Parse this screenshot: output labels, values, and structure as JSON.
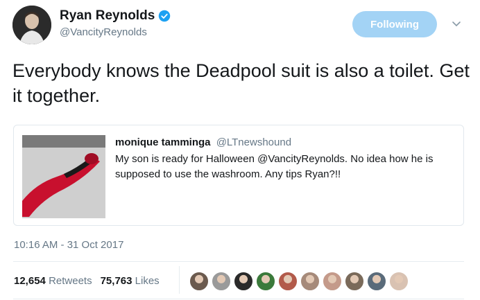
{
  "author": {
    "display_name": "Ryan Reynolds",
    "handle": "@VancityReynolds",
    "verified": true
  },
  "follow_button": {
    "label": "Following"
  },
  "tweet": {
    "text": "Everybody knows the Deadpool suit is also a toilet. Get it together."
  },
  "quoted_tweet": {
    "display_name": "monique tamminga",
    "handle": "@LTnewshound",
    "text": "My son is ready for Halloween @VancityReynolds. No idea how he is supposed to use the washroom. Any tips Ryan?!!"
  },
  "timestamp": "10:16 AM - 31 Oct 2017",
  "stats": {
    "retweets_count": "12,654",
    "retweets_label": "Retweets",
    "likes_count": "75,763",
    "likes_label": "Likes"
  },
  "likers": [
    {
      "color": "#6b5a4e"
    },
    {
      "color": "#9a9a9a"
    },
    {
      "color": "#2a2a2a"
    },
    {
      "color": "#3b7a3b"
    },
    {
      "color": "#b25a4a"
    },
    {
      "color": "#a68a7a"
    },
    {
      "color": "#c49a8a"
    },
    {
      "color": "#7a6a5a"
    },
    {
      "color": "#5a6b7a"
    },
    {
      "color": "#d9c2b2"
    }
  ],
  "colors": {
    "accent": "#1da1f2",
    "follow_button_bg": "#a3d3f5",
    "secondary_text": "#657786"
  }
}
